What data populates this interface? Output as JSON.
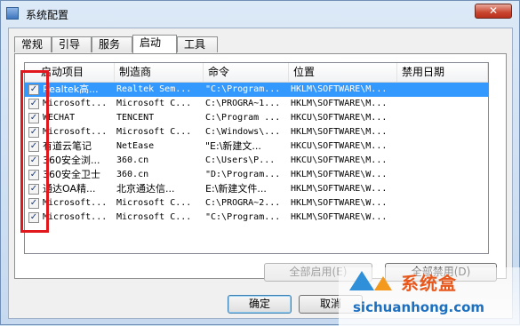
{
  "window": {
    "title": "系统配置",
    "close_label": "✕"
  },
  "tabs": [
    {
      "label": "常规"
    },
    {
      "label": "引导"
    },
    {
      "label": "服务"
    },
    {
      "label": "启动"
    },
    {
      "label": "工具"
    }
  ],
  "active_tab": "启动",
  "table": {
    "columns": [
      "启动项目",
      "制造商",
      "命令",
      "位置",
      "禁用日期"
    ],
    "rows": [
      {
        "checked": true,
        "item": "Realtek高...",
        "maker": "Realtek Sem...",
        "command": "\"C:\\Program...",
        "location": "HKLM\\SOFTWARE\\M...",
        "disabled_date": ""
      },
      {
        "checked": true,
        "item": "Microsoft...",
        "maker": "Microsoft C...",
        "command": "C:\\PROGRA~1...",
        "location": "HKLM\\SOFTWARE\\M...",
        "disabled_date": ""
      },
      {
        "checked": true,
        "item": "WECHAT",
        "maker": "TENCENT",
        "command": "C:\\Program ...",
        "location": "HKCU\\SOFTWARE\\M...",
        "disabled_date": ""
      },
      {
        "checked": true,
        "item": "Microsoft...",
        "maker": "Microsoft C...",
        "command": "C:\\Windows\\...",
        "location": "HKLM\\SOFTWARE\\M...",
        "disabled_date": ""
      },
      {
        "checked": true,
        "item": "有道云笔记",
        "maker": "NetEase",
        "command": "\"E:\\新建文...",
        "location": "HKCU\\SOFTWARE\\M...",
        "disabled_date": ""
      },
      {
        "checked": true,
        "item": "360安全浏...",
        "maker": "360.cn",
        "command": "C:\\Users\\P...",
        "location": "HKCU\\SOFTWARE\\M...",
        "disabled_date": ""
      },
      {
        "checked": true,
        "item": "360安全卫士",
        "maker": "360.cn",
        "command": "\"D:\\Program...",
        "location": "HKLM\\SOFTWARE\\W...",
        "disabled_date": ""
      },
      {
        "checked": true,
        "item": "通达OA精...",
        "maker": "北京通达信...",
        "command": "E:\\新建文件...",
        "location": "HKLM\\SOFTWARE\\W...",
        "disabled_date": ""
      },
      {
        "checked": true,
        "item": "Microsoft...",
        "maker": "Microsoft C...",
        "command": "C:\\PROGRA~2...",
        "location": "HKLM\\SOFTWARE\\W...",
        "disabled_date": ""
      },
      {
        "checked": true,
        "item": "Microsoft...",
        "maker": "Microsoft C...",
        "command": "\"C:\\Program...",
        "location": "HKLM\\SOFTWARE\\W...",
        "disabled_date": ""
      }
    ],
    "selected_row": 0,
    "checkmark": "✓"
  },
  "buttons": {
    "enable_all": "全部启用(E)",
    "disable_all": "全部禁用(D)",
    "ok": "确定",
    "cancel": "取消"
  },
  "watermark": {
    "title": "系统盒",
    "url": "sichuanhong.com"
  },
  "colors": {
    "selection": "#3399ff",
    "highlight_box": "#e0181d"
  }
}
